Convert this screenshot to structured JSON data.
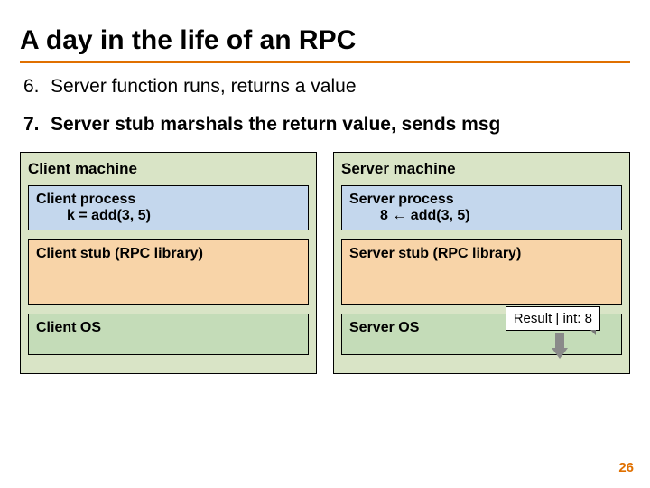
{
  "title": "A day in the life of an RPC",
  "items": [
    {
      "num": "6.",
      "text": "Server function runs, returns a value",
      "bold": false
    },
    {
      "num": "7.",
      "text": "Server stub marshals the return value, sends msg",
      "bold": true
    }
  ],
  "client": {
    "label": "Client machine",
    "process_line1": "Client process",
    "process_line2": "k = add(3, 5)",
    "stub": "Client stub (RPC library)",
    "os": "Client OS"
  },
  "server": {
    "label": "Server machine",
    "process_line1": "Server process",
    "process_line2": "8 ← add(3, 5)",
    "stub": "Server stub (RPC library)",
    "os": "Server OS"
  },
  "result_badge": "Result | int: 8",
  "page_number": "26"
}
